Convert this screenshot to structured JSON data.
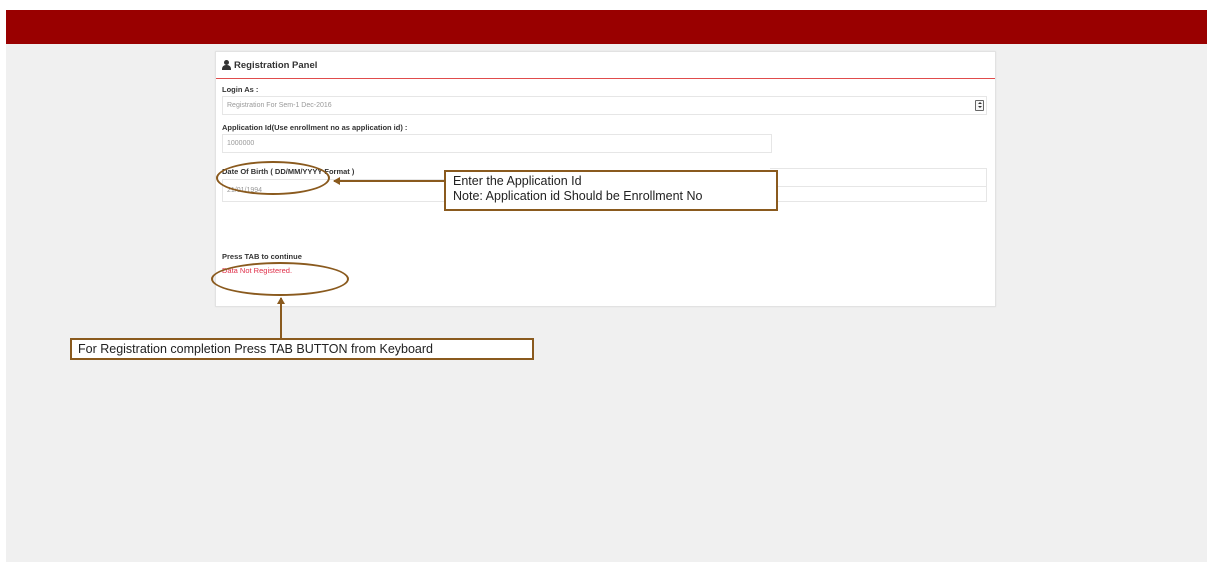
{
  "panel": {
    "title": "Registration Panel",
    "icon": "user-icon"
  },
  "form": {
    "login_as_label": "Login As :",
    "login_as_value": "Registration For Sem-1 Dec-2016",
    "application_id_label": "Application Id(Use enrollment no as application id) :",
    "application_id_value": "1000000",
    "dob_label": "Date Of Birth ( DD/MM/YYYY Format )",
    "dob_value": "21/01/1994",
    "press_tab": "Press TAB to continue",
    "error": "Data Not Registered."
  },
  "annotations": {
    "callout_app_id_line1": "Enter the Application Id",
    "callout_app_id_line2": "Note: Application id Should be Enrollment No",
    "callout_tab": "For Registration completion Press TAB BUTTON from Keyboard"
  },
  "colors": {
    "topbar": "#990000",
    "panel_underline": "#e04c4c",
    "annotation_border": "#8a5a1e",
    "error_text": "#e0304a"
  }
}
